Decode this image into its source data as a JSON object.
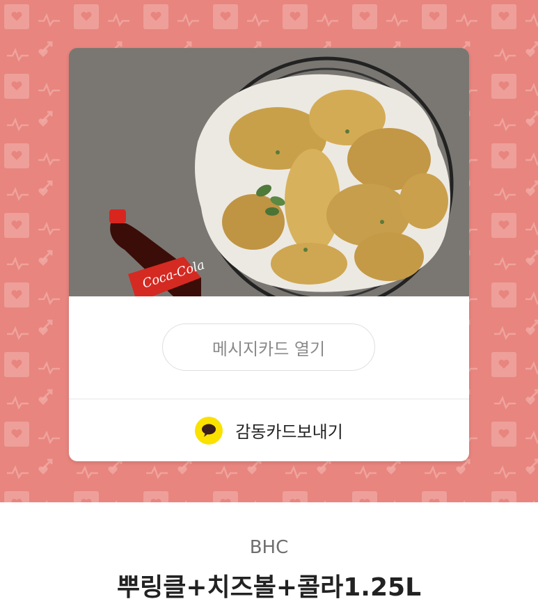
{
  "card": {
    "open_button_label": "메시지카드 열기",
    "send_button_label": "감동카드보내기",
    "send_icon": "kakao-talk-icon",
    "bottle_text": "Coca-Cola"
  },
  "product": {
    "brand": "BHC",
    "name": "뿌링클+치즈볼+콜라1.25L"
  },
  "colors": {
    "pattern_background": "#e8857f",
    "kakao_yellow": "#fae100"
  }
}
